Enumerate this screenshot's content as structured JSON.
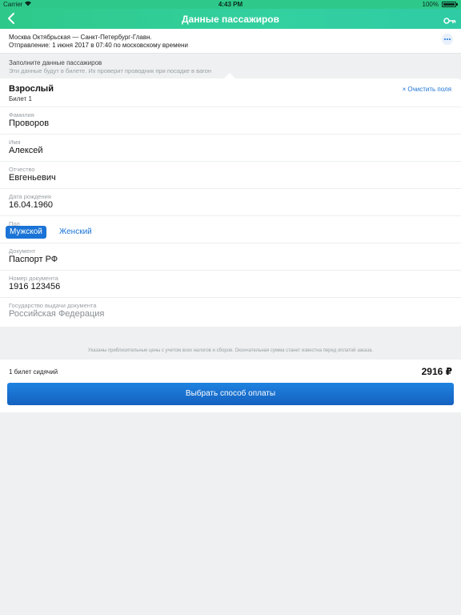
{
  "status_bar": {
    "carrier": "Carrier",
    "wifi_icon": "wifi-icon",
    "time": "4:43 PM",
    "battery_percent": "100%"
  },
  "nav": {
    "back_icon": "chevron-left-icon",
    "title": "Данные пассажиров",
    "key_icon": "key-icon"
  },
  "trip": {
    "route": "Москва Октябрьская — Санкт-Петербург-Главн.",
    "departure": "Отправление: 1 июня 2017 в 07:40  по московскому времени",
    "more_icon": "more-dots-icon"
  },
  "hint": {
    "title": "Заполните данные пассажиров",
    "subtitle": "Эти данные будут в билете. Их проверит проводник при посадке в вагон"
  },
  "passenger": {
    "type": "Взрослый",
    "ticket": "Билет 1",
    "clear_label": "Очистить поля",
    "clear_icon_char": "×",
    "fields": [
      {
        "label": "Фамилия",
        "value": "Проворов"
      },
      {
        "label": "Имя",
        "value": "Алексей"
      },
      {
        "label": "Отчество",
        "value": "Евгеньевич"
      },
      {
        "label": "Дата рождения",
        "value": "16.04.1960"
      },
      {
        "label": "Пол",
        "value": ""
      },
      {
        "label": "Документ",
        "value": "Паспорт РФ"
      },
      {
        "label": "Номер документа",
        "value": "1916 123456"
      },
      {
        "label": "Государство выдачи документа",
        "value": "Российская Федерация"
      }
    ],
    "gender": {
      "male": "Мужской",
      "female": "Женский",
      "selected": "Мужской"
    }
  },
  "disclaimer": "Указаны приблизительные цены с учетом всех налогов и сборов. Окончательная сумма станет известна перед оплатой заказа.",
  "summary": {
    "count": "1 билет сидячий",
    "price": "2916 ₽",
    "pay_button": "Выбрать способ оплаты"
  },
  "colors": {
    "accent": "#1a73d6",
    "nav": "#2ec98a"
  }
}
